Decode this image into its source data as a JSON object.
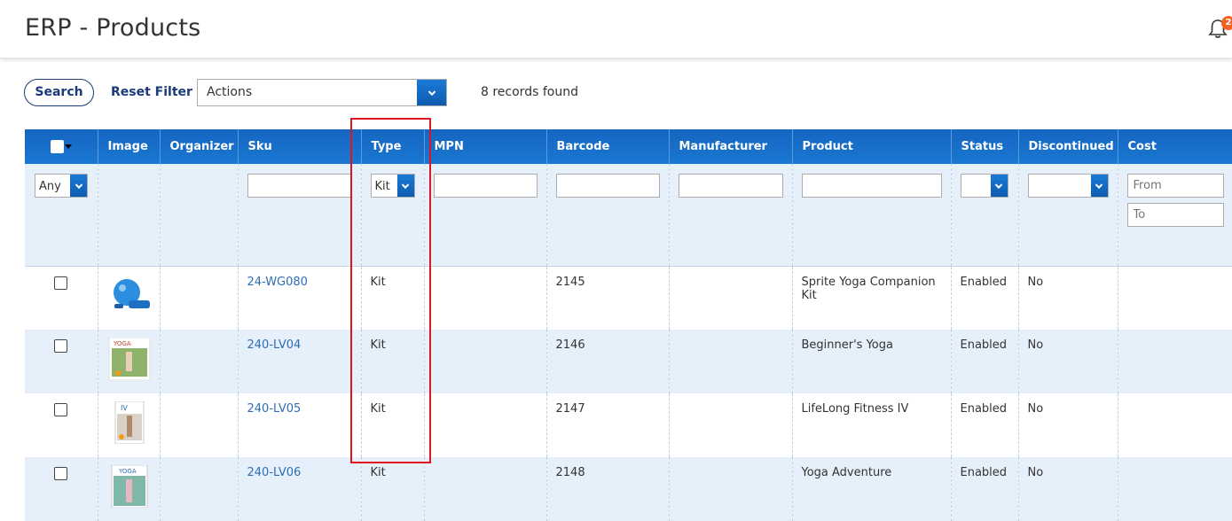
{
  "header": {
    "title": "ERP - Products",
    "notification_count": "2"
  },
  "toolbar": {
    "search_label": "Search",
    "reset_label": "Reset Filter",
    "actions_value": "Actions",
    "records_text": "8 records found"
  },
  "columns": [
    "Image",
    "Organizer",
    "Sku",
    "Type",
    "MPN",
    "Barcode",
    "Manufacturer",
    "Product",
    "Status",
    "Discontinued",
    "Cost"
  ],
  "filters": {
    "select_any": "Any",
    "type_value": "Kit",
    "cost_from_placeholder": "From",
    "cost_to_placeholder": "To"
  },
  "rows": [
    {
      "sku": "24-WG080",
      "type": "Kit",
      "barcode": "2145",
      "product": "Sprite Yoga Companion Kit",
      "status": "Enabled",
      "discontinued": "No",
      "image": "yoga-ball-kit"
    },
    {
      "sku": "240-LV04",
      "type": "Kit",
      "barcode": "2146",
      "product": "Beginner's Yoga",
      "status": "Enabled",
      "discontinued": "No",
      "image": "yoga-dvd"
    },
    {
      "sku": "240-LV05",
      "type": "Kit",
      "barcode": "2147",
      "product": "LifeLong Fitness IV",
      "status": "Enabled",
      "discontinued": "No",
      "image": "fitness-dvd"
    },
    {
      "sku": "240-LV06",
      "type": "Kit",
      "barcode": "2148",
      "product": "Yoga Adventure",
      "status": "Enabled",
      "discontinued": "No",
      "image": "yoga-dvd"
    }
  ],
  "colors": {
    "header_blue": "#1565c0",
    "link": "#2e6db4",
    "alt_row": "#e6f0fb",
    "highlight": "#e0141e",
    "badge": "#f26322"
  }
}
